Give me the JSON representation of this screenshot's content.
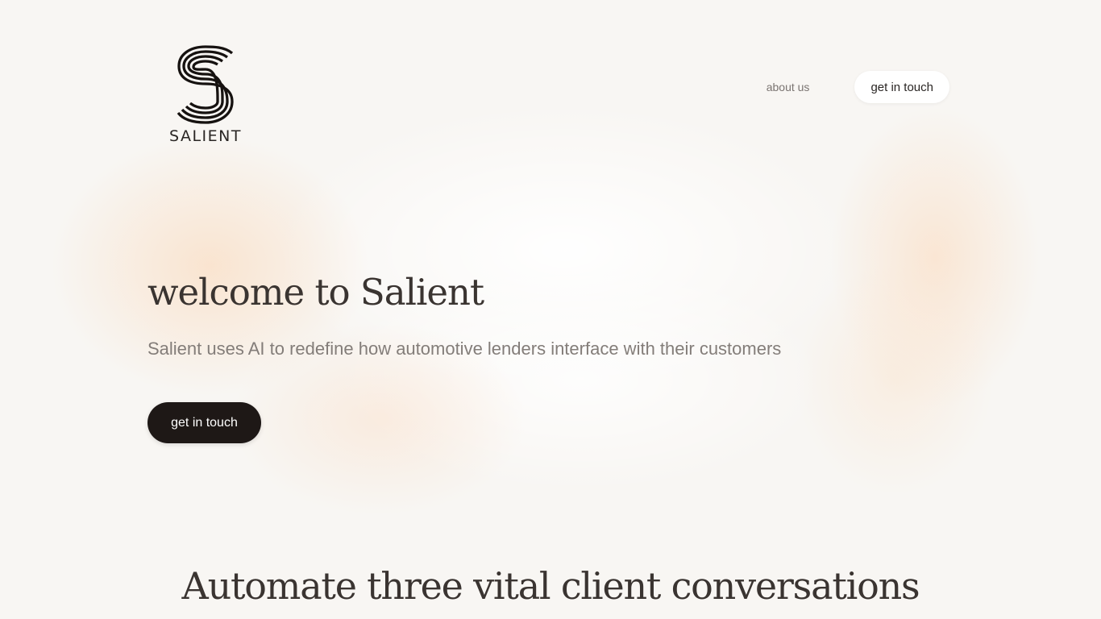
{
  "brand": {
    "name": "SALIENT",
    "logo_icon": "salient-s-logo-icon"
  },
  "nav": {
    "about_label": "about us",
    "contact_label": "get in touch"
  },
  "hero": {
    "title": "welcome to Salient",
    "subtitle": "Salient uses AI to redefine how automotive lenders interface with their customers",
    "cta_label": "get in touch"
  },
  "section": {
    "title": "Automate three vital client conversations"
  },
  "colors": {
    "background": "#f8f6f3",
    "glow": "#fadec4",
    "cta_bg": "#1e1816",
    "text": "#3a3431"
  }
}
